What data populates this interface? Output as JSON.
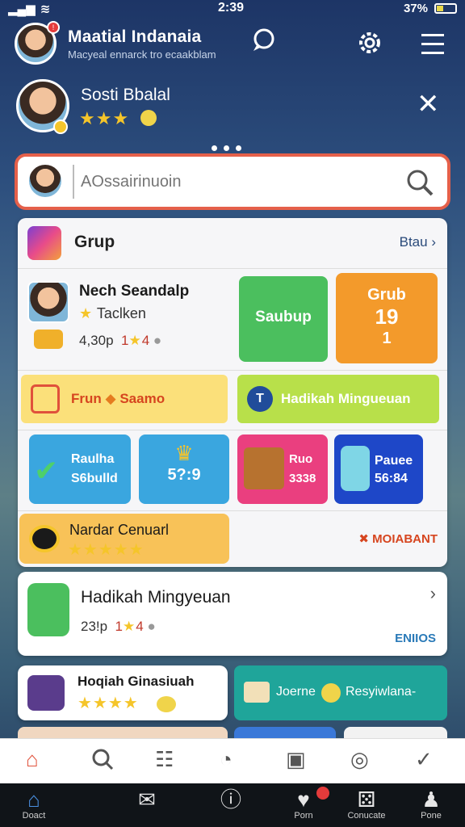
{
  "status_bar": {
    "time": "2:39",
    "battery": "37%",
    "battery_level": 0.37
  },
  "header": {
    "title": "Maatial Indanaia",
    "subtitle": "Macyeal ennarck tro ecaakblam",
    "icons": {
      "chat": "chat-bubble-icon",
      "settings": "gear-icon",
      "menu": "hamburger-menu-icon"
    }
  },
  "profile": {
    "name": "Sosti Bbalal",
    "stars": "★★★"
  },
  "search": {
    "placeholder": "AOssairinuoin"
  },
  "group": {
    "title": "Grup",
    "link": "Btau"
  },
  "featured": {
    "name": "Nech Seandalp",
    "subtitle": "Taclken",
    "stats": "4,30p",
    "rank": "1",
    "rank2": "4"
  },
  "tiles": {
    "green": "Saubup",
    "orange_title": "Grub",
    "orange_num": "19",
    "orange_sub": "1",
    "fruit": "Frun",
    "fruit_extra": "Saamo",
    "gift": "Hadikah Mingueuan",
    "blue1_title": "Raulha",
    "blue1_val": "S6bulld",
    "blue2_val": "5?:9",
    "pink_title": "Ruo",
    "pink_val": "3338",
    "navy_title": "Pauee",
    "navy_val": "56:84",
    "banner": "Nardar Cenuarl",
    "banner_stars": "★★★★★",
    "banner_right": "MOIABANT"
  },
  "reward_card": {
    "title": "Hadikah Mingyeuan",
    "stats": "23!p",
    "rank": "1",
    "rank2": "4",
    "link": "ENIIOS"
  },
  "bottom_cards": {
    "left_title": "Hoqiah Ginasiuah",
    "left_stars": "★★★★",
    "right_a": "Joerne",
    "right_b": "Resyiwlana-"
  },
  "tab_bar": [
    "home-icon",
    "search-icon",
    "news-icon",
    "history-icon",
    "apps-icon",
    "support-icon",
    "check-icon"
  ],
  "bottom_nav": [
    {
      "icon": "home-icon",
      "label": "Doact"
    },
    {
      "icon": "mail-icon",
      "label": ""
    },
    {
      "icon": "info-icon",
      "label": ""
    },
    {
      "icon": "heart-icon",
      "label": "Porn"
    },
    {
      "icon": "dice-icon",
      "label": "Conucate"
    },
    {
      "icon": "user-icon",
      "label": "Pone"
    }
  ]
}
